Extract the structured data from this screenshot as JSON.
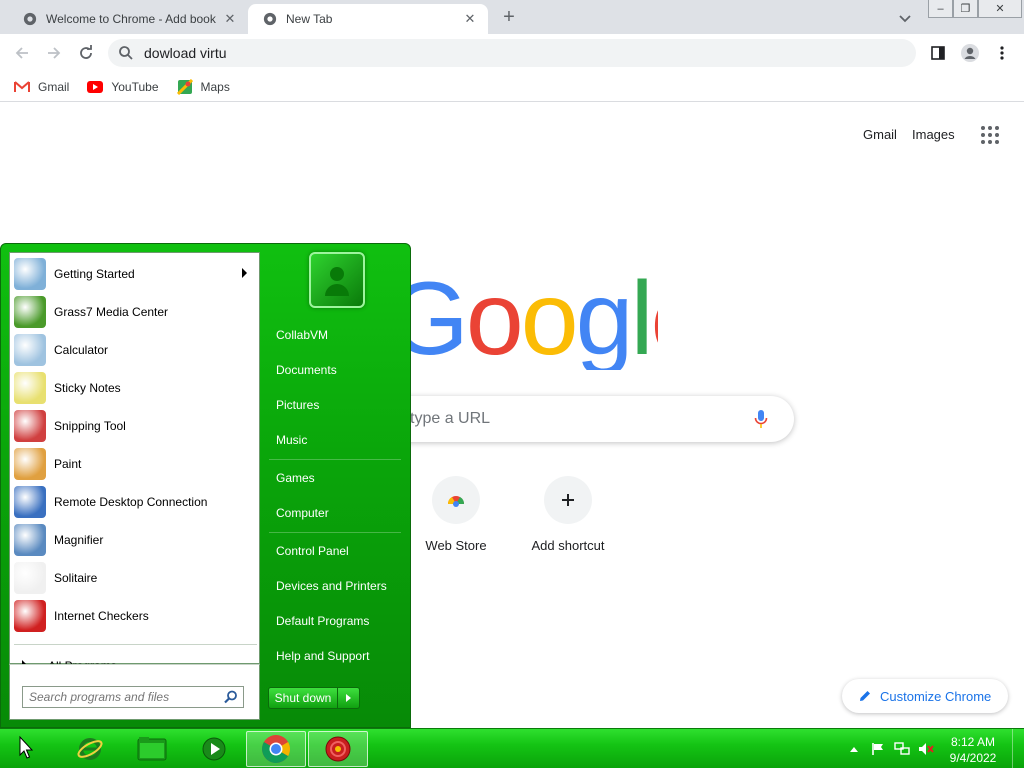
{
  "browser": {
    "tabs": [
      {
        "title": "Welcome to Chrome - Add book",
        "close": "✕"
      },
      {
        "title": "New Tab",
        "close": "✕"
      }
    ],
    "new_tab_symbol": "+",
    "window_controls": {
      "minimize": "–",
      "restore": "❐",
      "close": "✕"
    },
    "omnibox_text": "dowload virtu",
    "bookmarks": [
      {
        "label": "Gmail",
        "icon": "gmail-icon"
      },
      {
        "label": "YouTube",
        "icon": "youtube-icon"
      },
      {
        "label": "Maps",
        "icon": "maps-icon"
      }
    ]
  },
  "ntp": {
    "top_links": {
      "gmail": "Gmail",
      "images": "Images"
    },
    "logo_text": "Google",
    "search_placeholder": "type a URL",
    "shortcuts": [
      {
        "label": "Web Store",
        "icon": "webstore-icon"
      },
      {
        "label": "Add shortcut",
        "icon": "plus-icon"
      }
    ],
    "customize_label": "Customize Chrome"
  },
  "start_menu": {
    "programs": [
      {
        "label": "Getting Started",
        "icon": "getting-started-icon",
        "color": "#7fb0d8",
        "submenu": true
      },
      {
        "label": "Grass7 Media Center",
        "icon": "media-center-icon",
        "color": "#4a9a2a",
        "submenu": false
      },
      {
        "label": "Calculator",
        "icon": "calculator-icon",
        "color": "#9fc3e0",
        "submenu": false
      },
      {
        "label": "Sticky Notes",
        "icon": "sticky-notes-icon",
        "color": "#e8e070",
        "submenu": false
      },
      {
        "label": "Snipping Tool",
        "icon": "snipping-tool-icon",
        "color": "#d04040",
        "submenu": false
      },
      {
        "label": "Paint",
        "icon": "paint-icon",
        "color": "#e0a040",
        "submenu": false
      },
      {
        "label": "Remote Desktop Connection",
        "icon": "remote-desktop-icon",
        "color": "#3a70c0",
        "submenu": false
      },
      {
        "label": "Magnifier",
        "icon": "magnifier-icon",
        "color": "#5a8ac0",
        "submenu": false
      },
      {
        "label": "Solitaire",
        "icon": "solitaire-icon",
        "color": "#f0f0f0",
        "submenu": false
      },
      {
        "label": "Internet Checkers",
        "icon": "checkers-icon",
        "color": "#d02020",
        "submenu": false
      }
    ],
    "all_programs": "All Programs",
    "search_placeholder": "Search programs and files",
    "right_items": [
      "CollabVM",
      "Documents",
      "Pictures",
      "Music",
      "Games",
      "Computer",
      "Control Panel",
      "Devices and Printers",
      "Default Programs",
      "Help and Support"
    ],
    "shutdown_label": "Shut down"
  },
  "taskbar": {
    "clock_time": "8:12 AM",
    "clock_date": "9/4/2022",
    "tray_icons": [
      "chevron-up-icon",
      "flag-icon",
      "network-icon",
      "volume-muted-icon"
    ]
  },
  "colors": {
    "taskbar_green": "#14c414",
    "start_menu_green": "#0aa50a",
    "chrome_blue": "#1a73e8"
  }
}
